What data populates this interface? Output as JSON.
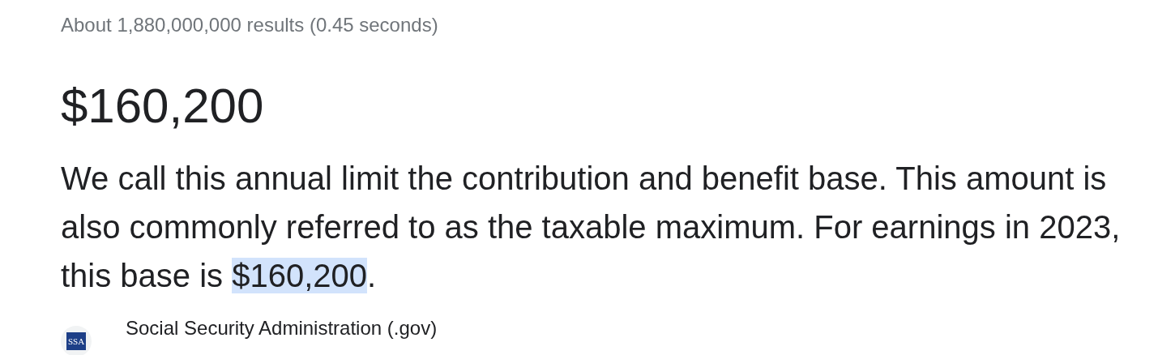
{
  "result_stats": "About 1,880,000,000 results (0.45 seconds)",
  "answer": "$160,200",
  "snippet": {
    "before": "We call this annual limit the contribution and benefit base. This amount is also commonly referred to as the taxable maximum. For earnings in 2023, this base is ",
    "highlight": "$160,200",
    "after": "."
  },
  "source": {
    "logo_text": "SSA",
    "name": "Social Security Administration (.gov)"
  }
}
